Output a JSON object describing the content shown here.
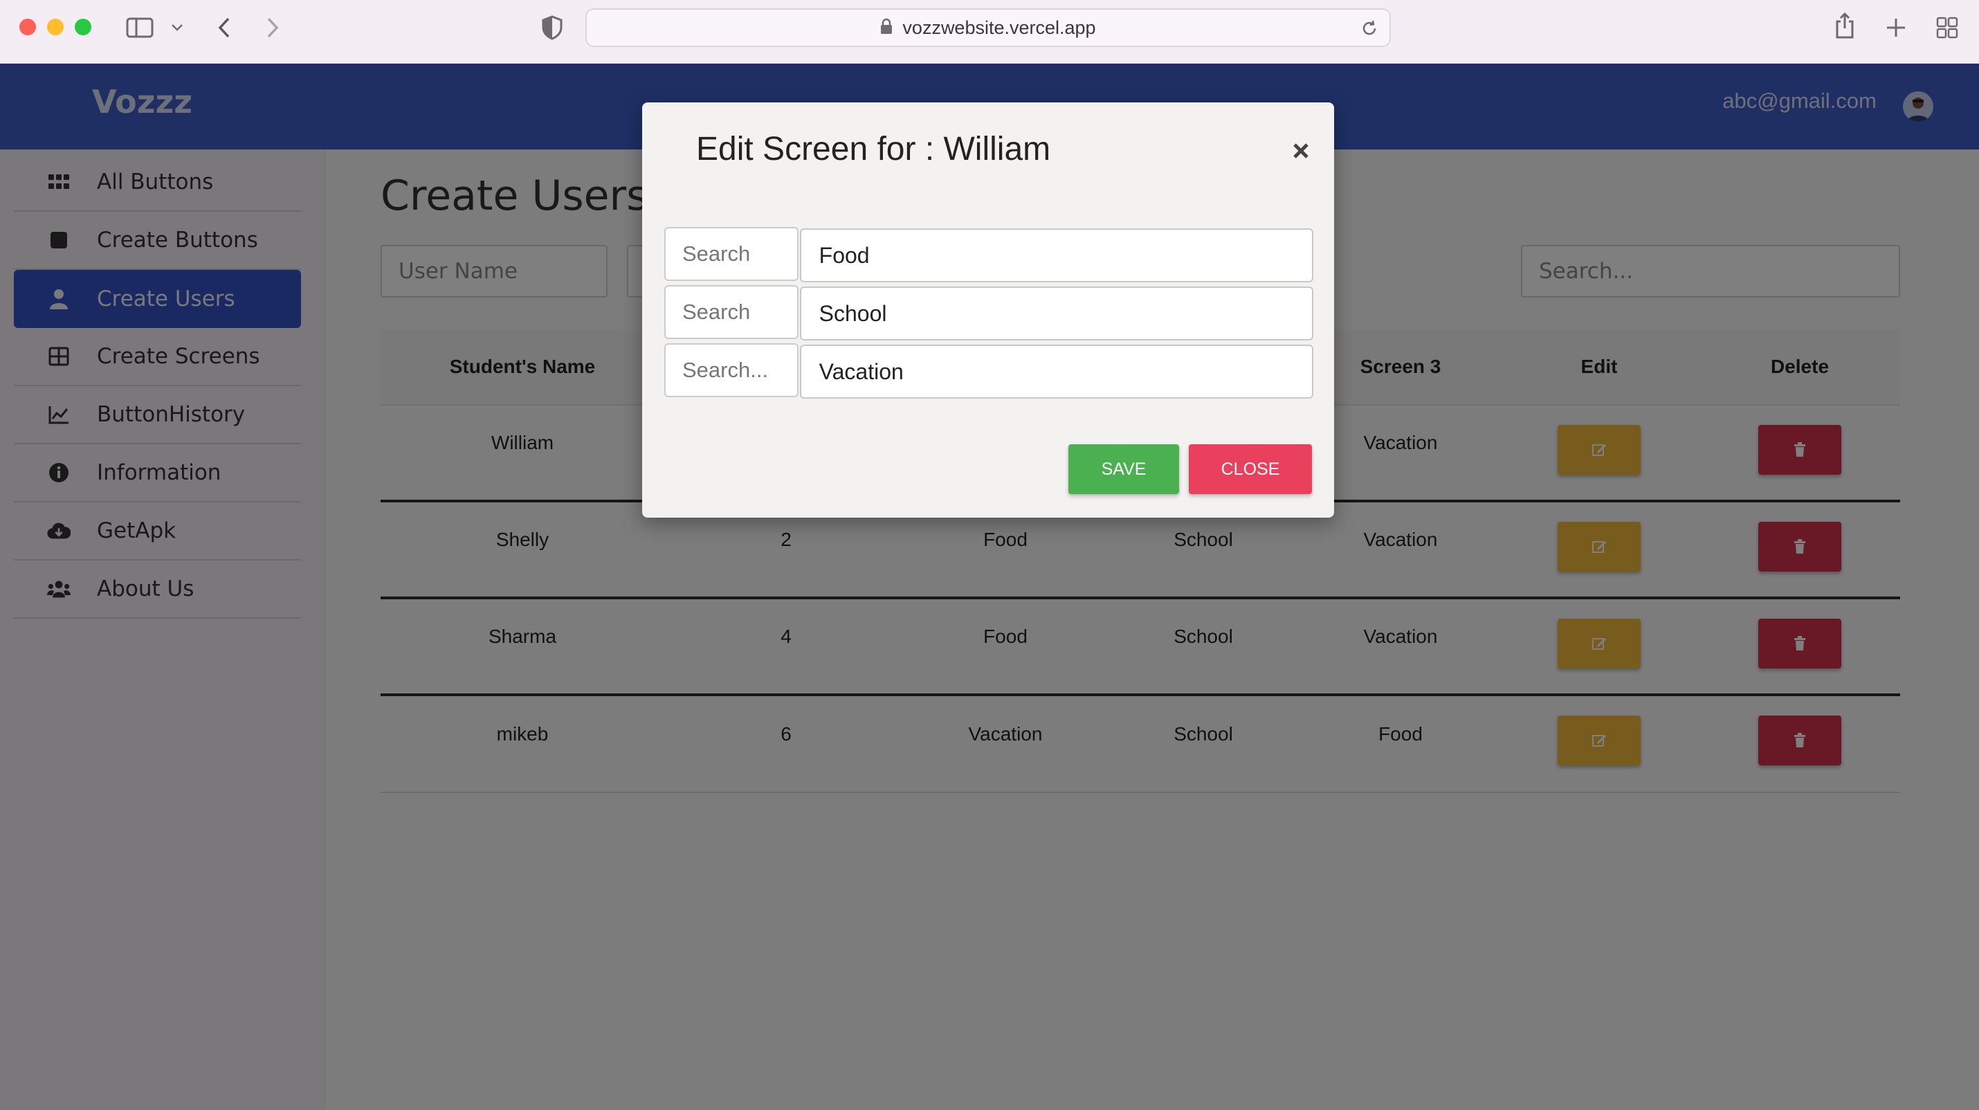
{
  "browser": {
    "url": "vozzwebsite.vercel.app"
  },
  "header": {
    "brand": "Vozzz",
    "user_email": "abc@gmail.com"
  },
  "sidebar": {
    "items": [
      {
        "label": "All Buttons",
        "icon": "grid-dots-icon"
      },
      {
        "label": "Create Buttons",
        "icon": "square-icon"
      },
      {
        "label": "Create Users",
        "icon": "user-icon",
        "active": true
      },
      {
        "label": "Create Screens",
        "icon": "table-icon"
      },
      {
        "label": "ButtonHistory",
        "icon": "line-chart-icon"
      },
      {
        "label": "Information",
        "icon": "info-icon"
      },
      {
        "label": "GetApk",
        "icon": "cloud-download-icon"
      },
      {
        "label": "About Us",
        "icon": "users-icon"
      }
    ]
  },
  "main": {
    "title": "Create Users",
    "username_placeholder": "User Name",
    "search_placeholder": "Search...",
    "table": {
      "headers": [
        "Student's Name",
        "",
        "",
        "",
        "Screen 3",
        "Edit",
        "Delete"
      ],
      "rows": [
        [
          "William",
          "",
          "",
          "",
          "Vacation"
        ],
        [
          "Shelly",
          "2",
          "Food",
          "School",
          "Vacation"
        ],
        [
          "Sharma",
          "4",
          "Food",
          "School",
          "Vacation"
        ],
        [
          "mikeb",
          "6",
          "Vacation",
          "School",
          "Food"
        ]
      ]
    }
  },
  "modal": {
    "title": "Edit Screen for : William",
    "rows": [
      {
        "search_placeholder": "Search",
        "value": "Food"
      },
      {
        "search_placeholder": "Search",
        "value": "School"
      },
      {
        "search_placeholder": "Search...",
        "value": "Vacation"
      }
    ],
    "save_label": "SAVE",
    "close_label": "CLOSE"
  },
  "colors": {
    "header": "#3f5fc8",
    "active_nav": "#3453c4",
    "save": "#4bb04f",
    "close": "#e8405d",
    "edit": "#f0b93c",
    "delete": "#d1334a"
  }
}
